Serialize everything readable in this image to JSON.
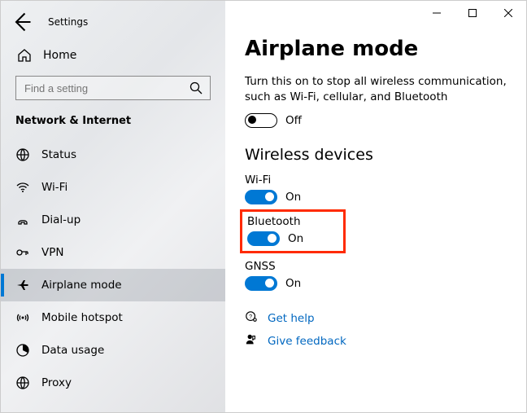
{
  "window": {
    "title": "Settings"
  },
  "sidebar": {
    "home": "Home",
    "searchPlaceholder": "Find a setting",
    "category": "Network & Internet",
    "items": [
      {
        "label": "Status"
      },
      {
        "label": "Wi-Fi"
      },
      {
        "label": "Dial-up"
      },
      {
        "label": "VPN"
      },
      {
        "label": "Airplane mode"
      },
      {
        "label": "Mobile hotspot"
      },
      {
        "label": "Data usage"
      },
      {
        "label": "Proxy"
      }
    ]
  },
  "page": {
    "title": "Airplane mode",
    "description": "Turn this on to stop all wireless communication, such as Wi-Fi, cellular, and Bluetooth",
    "mainToggle": {
      "state": "Off",
      "on": false
    },
    "sectionTitle": "Wireless devices",
    "devices": {
      "wifi": {
        "label": "Wi-Fi",
        "state": "On"
      },
      "bluetooth": {
        "label": "Bluetooth",
        "state": "On"
      },
      "gnss": {
        "label": "GNSS",
        "state": "On"
      }
    },
    "help": {
      "getHelp": "Get help",
      "giveFeedback": "Give feedback"
    }
  }
}
